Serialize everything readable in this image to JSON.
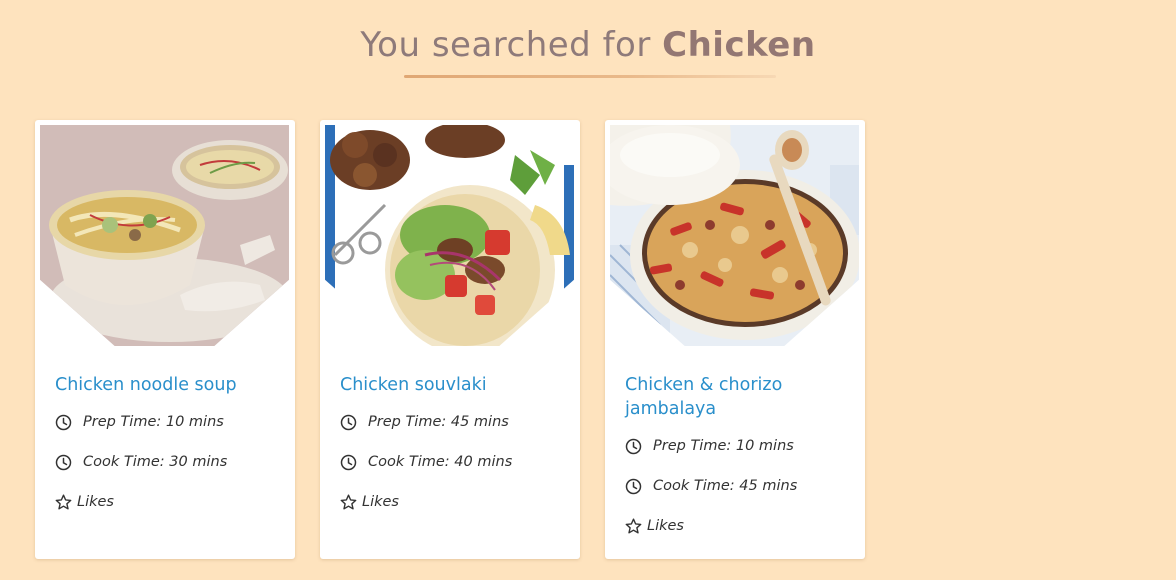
{
  "header": {
    "title_prefix": "You searched for",
    "query": "Chicken"
  },
  "recipes": [
    {
      "title": "Chicken noodle soup",
      "prep_time": "Prep Time: 10 mins",
      "cook_time": "Cook Time: 30 mins",
      "likes_label": "Likes",
      "image_icon": "noodle-soup-photo"
    },
    {
      "title": "Chicken souvlaki",
      "prep_time": "Prep Time: 45 mins",
      "cook_time": "Cook Time: 40 mins",
      "likes_label": "Likes",
      "image_icon": "souvlaki-photo"
    },
    {
      "title": "Chicken & chorizo jambalaya",
      "prep_time": "Prep Time: 10 mins",
      "cook_time": "Cook Time: 45 mins",
      "likes_label": "Likes",
      "image_icon": "jambalaya-photo"
    }
  ],
  "colors": {
    "background": "#FEE3BE",
    "link": "#2A8FCB",
    "title": "#8E7A7A",
    "underline": "#E0A774"
  }
}
